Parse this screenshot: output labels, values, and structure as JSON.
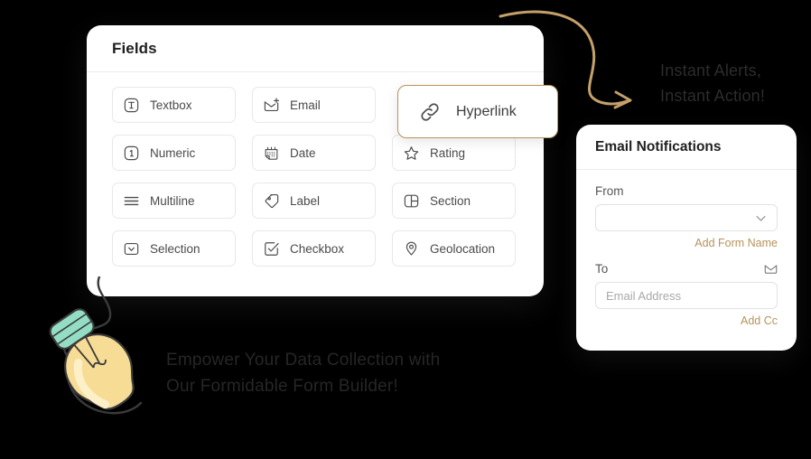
{
  "fields_panel": {
    "title": "Fields",
    "cards": [
      {
        "label": "Textbox",
        "icon": "textbox-icon"
      },
      {
        "label": "Email",
        "icon": "email-envelope-plus-icon"
      },
      {
        "label": "Numeric",
        "icon": "numeric-one-icon"
      },
      {
        "label": "Date",
        "icon": "calendar-icon"
      },
      {
        "label": "Rating",
        "icon": "star-icon"
      },
      {
        "label": "Multiline",
        "icon": "lines-icon"
      },
      {
        "label": "Label",
        "icon": "tag-icon"
      },
      {
        "label": "Section",
        "icon": "layout-section-icon"
      },
      {
        "label": "Selection",
        "icon": "dropdown-chevron-box-icon"
      },
      {
        "label": "Checkbox",
        "icon": "checkbox-check-icon"
      },
      {
        "label": "Geolocation",
        "icon": "map-pin-icon"
      }
    ],
    "highlighted_card": {
      "label": "Hyperlink",
      "icon": "link-chain-icon"
    }
  },
  "email_panel": {
    "title": "Email Notifications",
    "from": {
      "label": "From",
      "value": "",
      "dropdown_icon": "chevron-down-icon",
      "link": "Add Form Name"
    },
    "to": {
      "label": "To",
      "icon": "envelope-icon",
      "placeholder": "Email Address",
      "value": "",
      "link": "Add Cc"
    }
  },
  "headlines": {
    "alerts_line1": "Instant Alerts,",
    "alerts_line2": "Instant Action!",
    "tagline_line1": "Empower Your Data Collection with",
    "tagline_line2": "Our Formidable Form Builder!"
  },
  "decorations": {
    "arrow": "curved-arrow-icon",
    "bulb": "lightbulb-illustration"
  },
  "colors": {
    "background": "#000000",
    "panel": "#ffffff",
    "accent_gold": "#b8935a",
    "text_dark": "#1f1f1f",
    "text_muted": "#4a4a4a",
    "bulb_yellow": "#f6d98e",
    "bulb_mint": "#93ddc4"
  }
}
